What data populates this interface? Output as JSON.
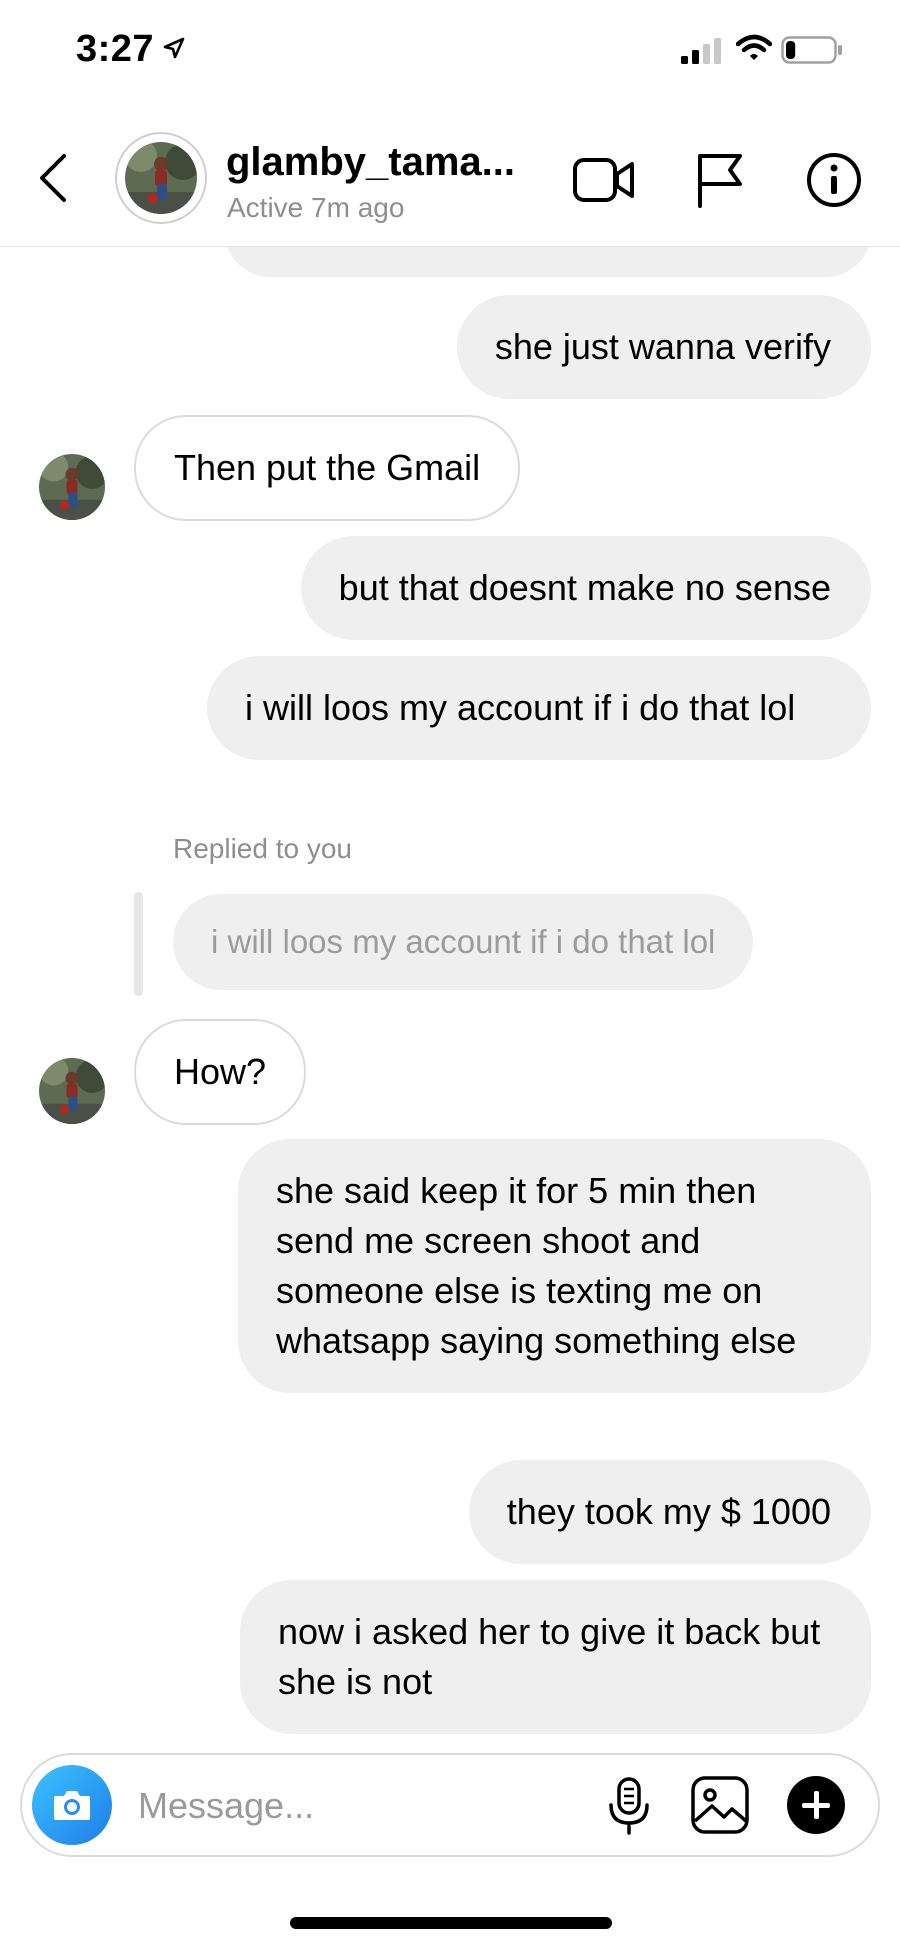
{
  "status_bar": {
    "time": "3:27",
    "battery_level": 0.2
  },
  "header": {
    "contact_name": "glamby_tama...",
    "contact_status": "Active 7m ago"
  },
  "thread": {
    "messages": [
      {
        "sender": "me",
        "text": "she just wanna verify"
      },
      {
        "sender": "them",
        "text": "Then put the Gmail"
      },
      {
        "sender": "me",
        "text": "but that doesnt make no sense"
      },
      {
        "sender": "me",
        "text": "i will loos my account if i do that lol"
      },
      {
        "sender": "them",
        "replied_label": "Replied to you",
        "quoted_text": "i will loos my account if i do that lol"
      },
      {
        "sender": "them",
        "text": "How?"
      },
      {
        "sender": "me",
        "text": "she said keep it for 5 min then send me screen shoot and someone else is texting me on whatsapp saying something else"
      },
      {
        "sender": "me",
        "text": "they took my $ 1000"
      },
      {
        "sender": "me",
        "text": "now i asked her to give it back but she is not"
      }
    ]
  },
  "composer": {
    "placeholder": "Message..."
  }
}
